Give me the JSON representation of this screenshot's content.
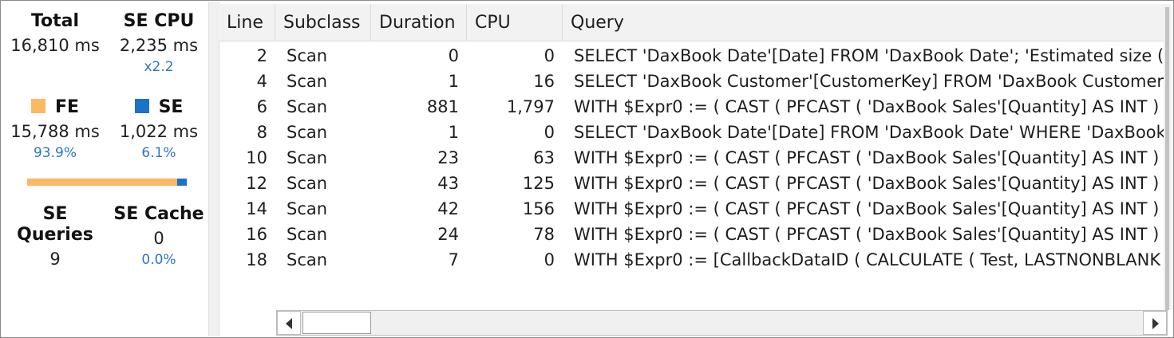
{
  "metrics": {
    "total": {
      "label": "Total",
      "value": "16,810 ms"
    },
    "se_cpu": {
      "label": "SE CPU",
      "value": "2,235 ms",
      "ratio": "x2.2"
    },
    "fe": {
      "label": "FE",
      "value": "15,788 ms",
      "pct": "93.9%",
      "color": "#fdb863"
    },
    "se": {
      "label": "SE",
      "value": "1,022 ms",
      "pct": "6.1%",
      "color": "#1a73c8"
    },
    "fe_se_bar": {
      "fe_fraction": 0.939,
      "se_fraction": 0.061
    },
    "se_queries": {
      "label": "SE Queries",
      "value": "9"
    },
    "se_cache": {
      "label": "SE Cache",
      "value": "0",
      "pct": "0.0%"
    }
  },
  "table": {
    "columns": [
      "Line",
      "Subclass",
      "Duration",
      "CPU",
      "Query"
    ],
    "rows": [
      {
        "line": "2",
        "subclass": "Scan",
        "duration": "0",
        "cpu": "0",
        "query": "SELECT 'DaxBook Date'[Date] FROM 'DaxBook Date';   'Estimated size ("
      },
      {
        "line": "4",
        "subclass": "Scan",
        "duration": "1",
        "cpu": "16",
        "query": "SELECT 'DaxBook Customer'[CustomerKey] FROM 'DaxBook Customer'"
      },
      {
        "line": "6",
        "subclass": "Scan",
        "duration": "881",
        "cpu": "1,797",
        "query": "WITH $Expr0 := ( CAST ( PFCAST ( 'DaxBook Sales'[Quantity] AS  INT ) /"
      },
      {
        "line": "8",
        "subclass": "Scan",
        "duration": "1",
        "cpu": "0",
        "query": "SELECT 'DaxBook Date'[Date] FROM 'DaxBook Date' WHERE 'DaxBook"
      },
      {
        "line": "10",
        "subclass": "Scan",
        "duration": "23",
        "cpu": "63",
        "query": "WITH $Expr0 := ( CAST ( PFCAST ( 'DaxBook Sales'[Quantity] AS  INT ) /"
      },
      {
        "line": "12",
        "subclass": "Scan",
        "duration": "43",
        "cpu": "125",
        "query": "WITH $Expr0 := ( CAST ( PFCAST ( 'DaxBook Sales'[Quantity] AS  INT ) /"
      },
      {
        "line": "14",
        "subclass": "Scan",
        "duration": "42",
        "cpu": "156",
        "query": "WITH $Expr0 := ( CAST ( PFCAST ( 'DaxBook Sales'[Quantity] AS  INT ) /"
      },
      {
        "line": "16",
        "subclass": "Scan",
        "duration": "24",
        "cpu": "78",
        "query": "WITH $Expr0 := ( CAST ( PFCAST ( 'DaxBook Sales'[Quantity] AS  INT ) /"
      },
      {
        "line": "18",
        "subclass": "Scan",
        "duration": "7",
        "cpu": "0",
        "query": "WITH $Expr0 := [CallbackDataID ( CALCULATE ( Test, LASTNONBLANK"
      }
    ]
  },
  "icons": {
    "scroll_left": "chevron-left-icon",
    "scroll_right": "chevron-right-icon"
  }
}
